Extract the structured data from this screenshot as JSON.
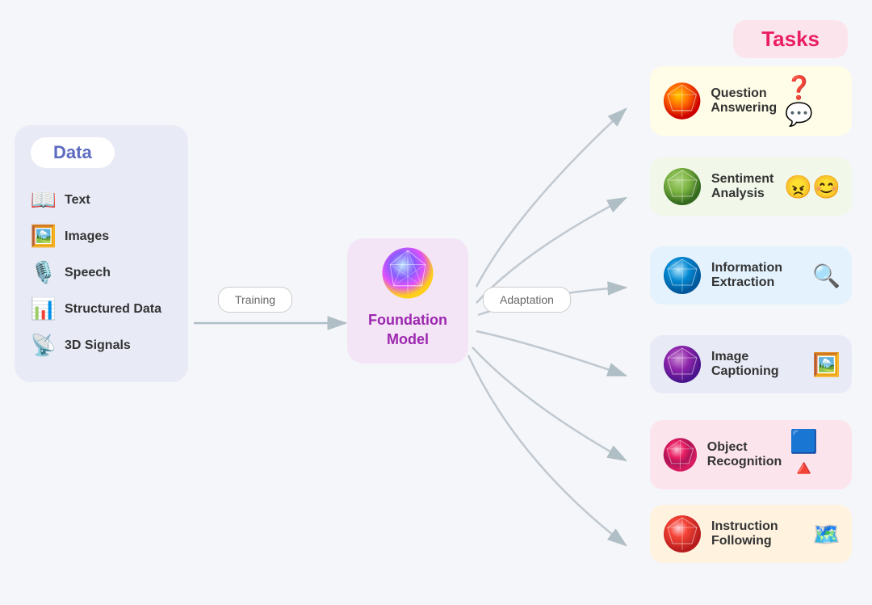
{
  "header": {
    "tasks_label": "Tasks"
  },
  "data_panel": {
    "title": "Data",
    "items": [
      {
        "label": "Text",
        "icon": "📖"
      },
      {
        "label": "Images",
        "icon": "🖼️"
      },
      {
        "label": "Speech",
        "icon": "🎙️"
      },
      {
        "label": "Structured Data",
        "icon": "📊"
      },
      {
        "label": "3D Signals",
        "icon": "📡"
      }
    ]
  },
  "training_label": "Training",
  "adaptation_label": "Adaptation",
  "foundation": {
    "title": "Foundation\nModel"
  },
  "tasks": [
    {
      "label": "Question\nAnswering",
      "emoji": "❓💬",
      "card_class": "card-qa"
    },
    {
      "label": "Sentiment\nAnalysis",
      "emoji": "😊😠",
      "card_class": "card-sa"
    },
    {
      "label": "Information\nExtraction",
      "emoji": "🔍",
      "card_class": "card-ie"
    },
    {
      "label": "Image\nCaptioning",
      "emoji": "🖼️",
      "card_class": "card-ic"
    },
    {
      "label": "Object\nRecognition",
      "emoji": "🟦🔺",
      "card_class": "card-or"
    },
    {
      "label": "Instruction\nFollowing",
      "emoji": "🗺️",
      "card_class": "card-if"
    }
  ]
}
